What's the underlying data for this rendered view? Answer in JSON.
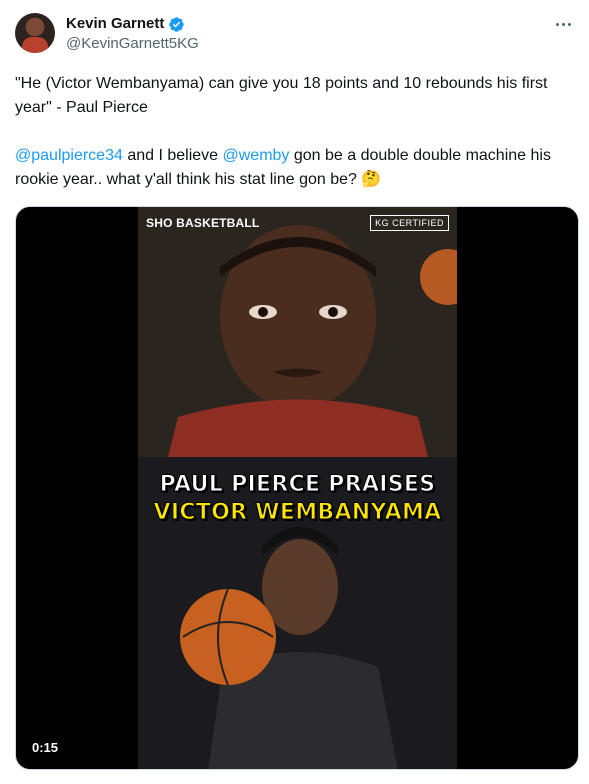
{
  "author": {
    "display_name": "Kevin Garnett",
    "handle": "@KevinGarnett5KG"
  },
  "tweet": {
    "line1": "\"He (Victor Wembanyama) can give you 18 points and 10 rebounds his first year\" - Paul Pierce",
    "mention1": "@paulpierce34",
    "text_mid": " and I believe ",
    "mention2": "@wemby",
    "text_end": " gon be a double double machine his rookie year.. what y'all think his stat line gon be? 🤔"
  },
  "video": {
    "network_label": "SHO BASKETBALL",
    "badge": "KG CERTIFIED",
    "headline_line1": "PAUL PIERCE PRAISES",
    "headline_line2": "VICTOR WEMBANYAMA",
    "duration": "0:15"
  },
  "colors": {
    "accent": "#1d9bf0",
    "headline_yellow": "#ffe600",
    "secondary_text": "#536471"
  }
}
